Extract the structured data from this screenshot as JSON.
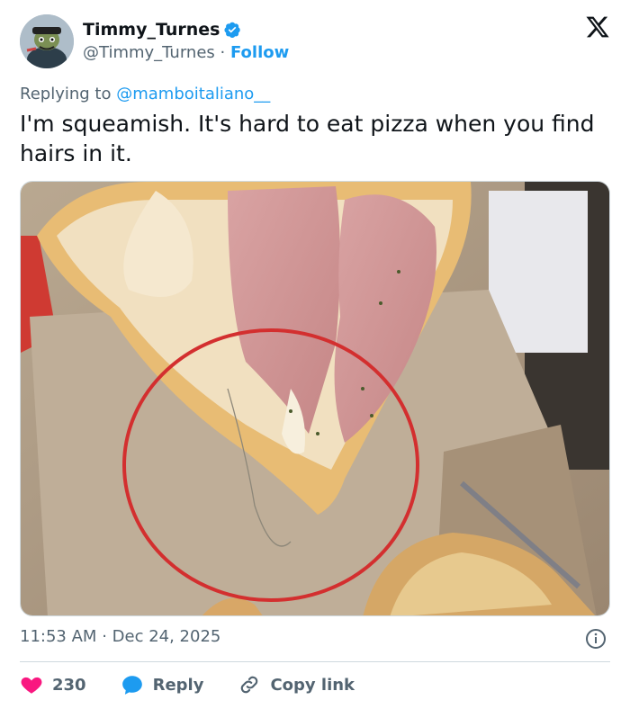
{
  "author": {
    "display_name": "Timmy_Turnes",
    "handle": "@Timmy_Turnes",
    "separator": "·",
    "follow_label": "Follow"
  },
  "reply": {
    "prefix": "Replying to",
    "mention": "@mamboitaliano__"
  },
  "tweet": {
    "text": "I'm squeamish. It's hard to eat pizza when you find hairs in it."
  },
  "meta": {
    "time": "11:53 AM",
    "separator": "·",
    "date": "Dec 24, 2025"
  },
  "actions": {
    "like_count": "230",
    "reply_label": "Reply",
    "copy_link_label": "Copy link"
  },
  "colors": {
    "accent": "#1d9bf0",
    "like": "#f91880",
    "muted": "#536471",
    "annotation_circle": "#d32f2f"
  },
  "icons": {
    "platform": "x-logo-icon",
    "verified": "verified-badge-icon",
    "info": "info-icon",
    "like": "heart-icon",
    "reply": "speech-bubble-icon",
    "copy_link": "link-icon"
  }
}
